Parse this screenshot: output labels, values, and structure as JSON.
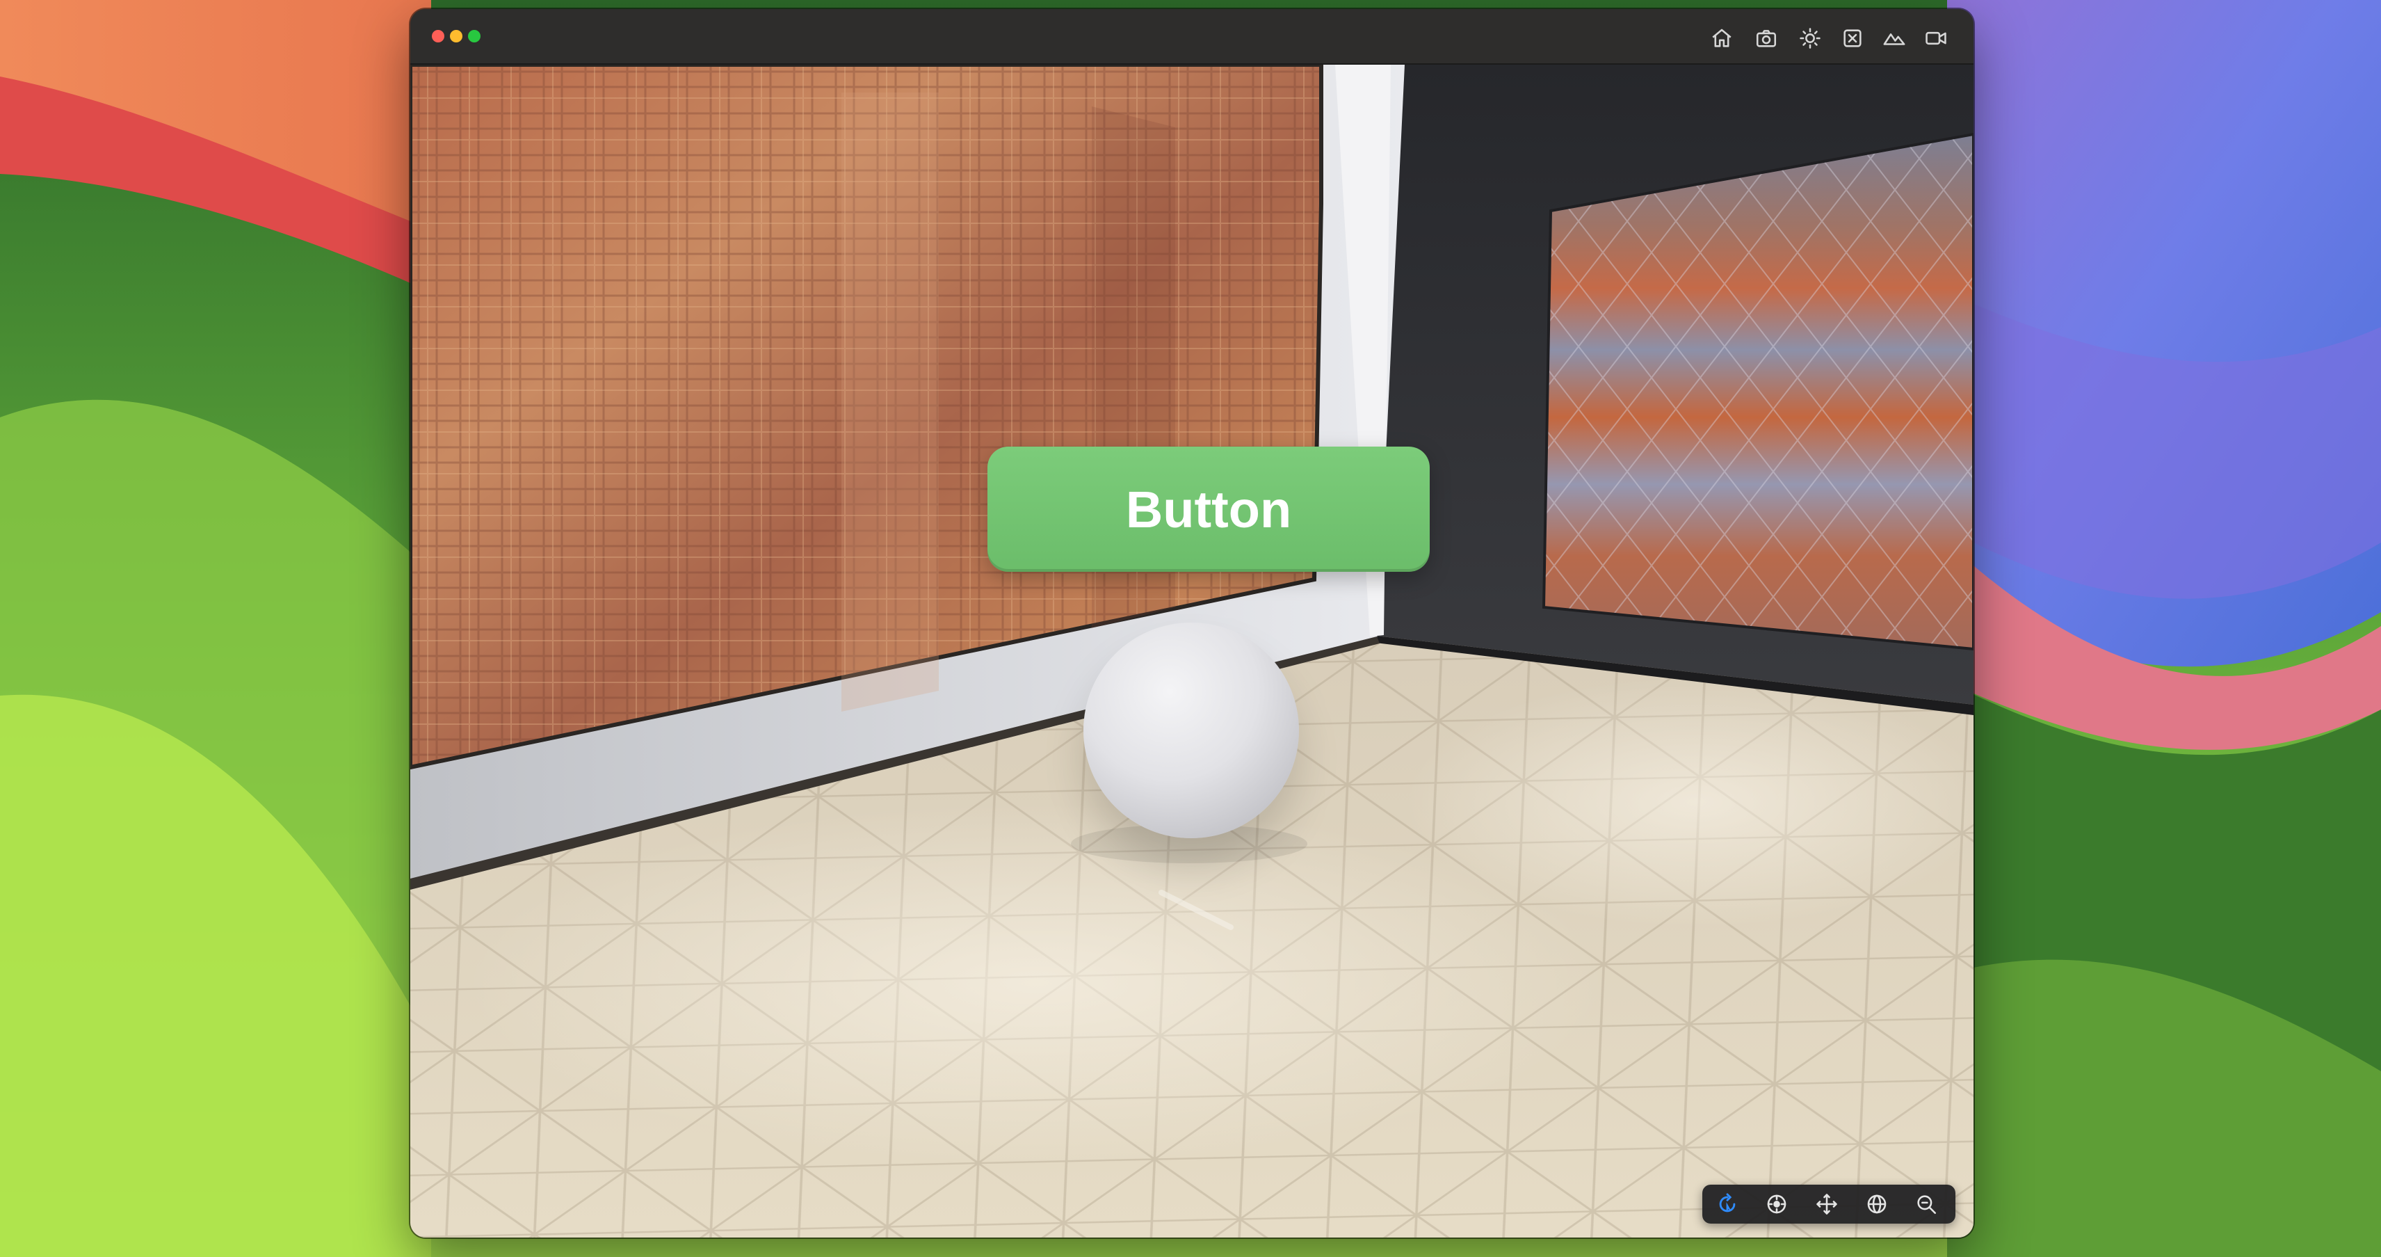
{
  "window": {
    "toolbar_icons": [
      "home-icon",
      "camera-icon",
      "lighting-icon",
      "entity-icon",
      "environment-icon",
      "video-camera-icon"
    ]
  },
  "scene": {
    "button_label": "Button"
  },
  "viewport_controls": {
    "items": [
      "orbit-icon",
      "pan-icon",
      "move-icon",
      "globe-icon",
      "zoom-icon"
    ],
    "active": "orbit-icon",
    "accent_color": "#2f8cff"
  },
  "colors": {
    "button_green": "#6fc36d",
    "window_chrome": "#2e2d2c"
  }
}
